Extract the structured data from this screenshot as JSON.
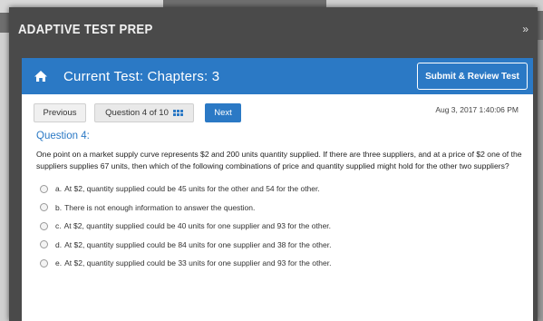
{
  "app": {
    "title": "ADAPTIVE TEST PREP",
    "expand_glyph": "»"
  },
  "header": {
    "title": "Current Test: Chapters: 3",
    "submit_label": "Submit & Review Test",
    "home_icon": "home-icon"
  },
  "toolbar": {
    "previous_label": "Previous",
    "question_selector_label": "Question 4 of 10",
    "question_selector_icon": "grid-icon",
    "next_label": "Next",
    "timestamp": "Aug 3, 2017 1:40:06 PM"
  },
  "question": {
    "label": "Question 4:",
    "text": "One point on a market supply curve represents $2 and 200 units quantity supplied. If there are three suppliers, and at a price of $2 one of the suppliers supplies 67 units, then which of the following combinations of price and quantity supplied might hold for the other two suppliers?",
    "options": [
      {
        "letter": "a.",
        "text": "At $2, quantity supplied could be 45 units for the other and 54 for the other."
      },
      {
        "letter": "b.",
        "text": "There is not enough information to answer the question."
      },
      {
        "letter": "c.",
        "text": "At $2, quantity supplied could be 40 units for one supplier and 93 for the other."
      },
      {
        "letter": "d.",
        "text": "At $2, quantity supplied could be 84 units for one supplier and 38 for the other."
      },
      {
        "letter": "e.",
        "text": "At $2, quantity supplied could be 33 units for one supplier and 93 for the other."
      }
    ]
  },
  "colors": {
    "accent": "#2b79c5",
    "window": "#4a4a4a"
  }
}
